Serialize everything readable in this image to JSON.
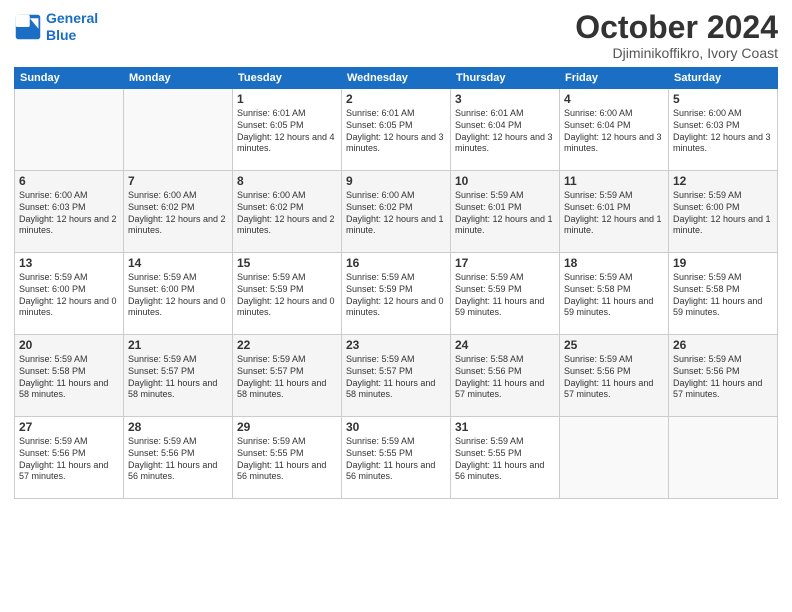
{
  "header": {
    "logo_line1": "General",
    "logo_line2": "Blue",
    "month_title": "October 2024",
    "subtitle": "Djiminikoffikro, Ivory Coast"
  },
  "weekdays": [
    "Sunday",
    "Monday",
    "Tuesday",
    "Wednesday",
    "Thursday",
    "Friday",
    "Saturday"
  ],
  "weeks": [
    [
      {
        "day": "",
        "text": ""
      },
      {
        "day": "",
        "text": ""
      },
      {
        "day": "1",
        "text": "Sunrise: 6:01 AM\nSunset: 6:05 PM\nDaylight: 12 hours and 4 minutes."
      },
      {
        "day": "2",
        "text": "Sunrise: 6:01 AM\nSunset: 6:05 PM\nDaylight: 12 hours and 3 minutes."
      },
      {
        "day": "3",
        "text": "Sunrise: 6:01 AM\nSunset: 6:04 PM\nDaylight: 12 hours and 3 minutes."
      },
      {
        "day": "4",
        "text": "Sunrise: 6:00 AM\nSunset: 6:04 PM\nDaylight: 12 hours and 3 minutes."
      },
      {
        "day": "5",
        "text": "Sunrise: 6:00 AM\nSunset: 6:03 PM\nDaylight: 12 hours and 3 minutes."
      }
    ],
    [
      {
        "day": "6",
        "text": "Sunrise: 6:00 AM\nSunset: 6:03 PM\nDaylight: 12 hours and 2 minutes."
      },
      {
        "day": "7",
        "text": "Sunrise: 6:00 AM\nSunset: 6:02 PM\nDaylight: 12 hours and 2 minutes."
      },
      {
        "day": "8",
        "text": "Sunrise: 6:00 AM\nSunset: 6:02 PM\nDaylight: 12 hours and 2 minutes."
      },
      {
        "day": "9",
        "text": "Sunrise: 6:00 AM\nSunset: 6:02 PM\nDaylight: 12 hours and 1 minute."
      },
      {
        "day": "10",
        "text": "Sunrise: 5:59 AM\nSunset: 6:01 PM\nDaylight: 12 hours and 1 minute."
      },
      {
        "day": "11",
        "text": "Sunrise: 5:59 AM\nSunset: 6:01 PM\nDaylight: 12 hours and 1 minute."
      },
      {
        "day": "12",
        "text": "Sunrise: 5:59 AM\nSunset: 6:00 PM\nDaylight: 12 hours and 1 minute."
      }
    ],
    [
      {
        "day": "13",
        "text": "Sunrise: 5:59 AM\nSunset: 6:00 PM\nDaylight: 12 hours and 0 minutes."
      },
      {
        "day": "14",
        "text": "Sunrise: 5:59 AM\nSunset: 6:00 PM\nDaylight: 12 hours and 0 minutes."
      },
      {
        "day": "15",
        "text": "Sunrise: 5:59 AM\nSunset: 5:59 PM\nDaylight: 12 hours and 0 minutes."
      },
      {
        "day": "16",
        "text": "Sunrise: 5:59 AM\nSunset: 5:59 PM\nDaylight: 12 hours and 0 minutes."
      },
      {
        "day": "17",
        "text": "Sunrise: 5:59 AM\nSunset: 5:59 PM\nDaylight: 11 hours and 59 minutes."
      },
      {
        "day": "18",
        "text": "Sunrise: 5:59 AM\nSunset: 5:58 PM\nDaylight: 11 hours and 59 minutes."
      },
      {
        "day": "19",
        "text": "Sunrise: 5:59 AM\nSunset: 5:58 PM\nDaylight: 11 hours and 59 minutes."
      }
    ],
    [
      {
        "day": "20",
        "text": "Sunrise: 5:59 AM\nSunset: 5:58 PM\nDaylight: 11 hours and 58 minutes."
      },
      {
        "day": "21",
        "text": "Sunrise: 5:59 AM\nSunset: 5:57 PM\nDaylight: 11 hours and 58 minutes."
      },
      {
        "day": "22",
        "text": "Sunrise: 5:59 AM\nSunset: 5:57 PM\nDaylight: 11 hours and 58 minutes."
      },
      {
        "day": "23",
        "text": "Sunrise: 5:59 AM\nSunset: 5:57 PM\nDaylight: 11 hours and 58 minutes."
      },
      {
        "day": "24",
        "text": "Sunrise: 5:58 AM\nSunset: 5:56 PM\nDaylight: 11 hours and 57 minutes."
      },
      {
        "day": "25",
        "text": "Sunrise: 5:59 AM\nSunset: 5:56 PM\nDaylight: 11 hours and 57 minutes."
      },
      {
        "day": "26",
        "text": "Sunrise: 5:59 AM\nSunset: 5:56 PM\nDaylight: 11 hours and 57 minutes."
      }
    ],
    [
      {
        "day": "27",
        "text": "Sunrise: 5:59 AM\nSunset: 5:56 PM\nDaylight: 11 hours and 57 minutes."
      },
      {
        "day": "28",
        "text": "Sunrise: 5:59 AM\nSunset: 5:56 PM\nDaylight: 11 hours and 56 minutes."
      },
      {
        "day": "29",
        "text": "Sunrise: 5:59 AM\nSunset: 5:55 PM\nDaylight: 11 hours and 56 minutes."
      },
      {
        "day": "30",
        "text": "Sunrise: 5:59 AM\nSunset: 5:55 PM\nDaylight: 11 hours and 56 minutes."
      },
      {
        "day": "31",
        "text": "Sunrise: 5:59 AM\nSunset: 5:55 PM\nDaylight: 11 hours and 56 minutes."
      },
      {
        "day": "",
        "text": ""
      },
      {
        "day": "",
        "text": ""
      }
    ]
  ]
}
